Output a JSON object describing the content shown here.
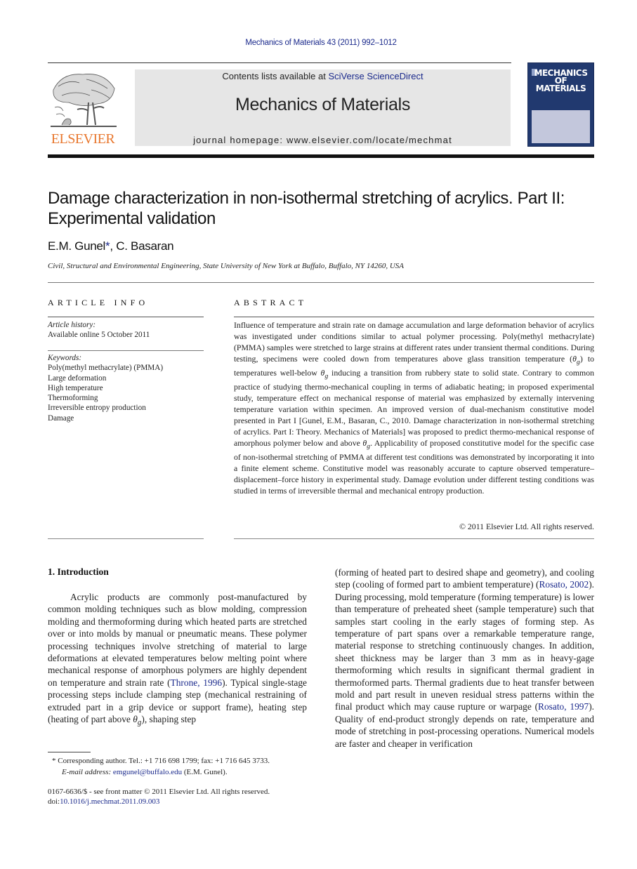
{
  "header": {
    "journal_ref": "Mechanics of Materials 43 (2011) 992–1012",
    "contents_prefix": "Contents lists available at ",
    "contents_link": "SciVerse ScienceDirect",
    "journal_title": "Mechanics of Materials",
    "homepage": "journal homepage: www.elsevier.com/locate/mechmat",
    "publisher_logo_text": "ELSEVIER",
    "cover_title_lines": [
      "MECHANICS",
      "OF",
      "MATERIALS"
    ],
    "colors": {
      "link_blue": "#1b2a8c",
      "elsevier_orange": "#e8772e",
      "cover_navy": "#21396f",
      "masthead_gray": "#e6e6e6"
    }
  },
  "article": {
    "title": "Damage characterization in non-isothermal stretching of acrylics. Part II: Experimental validation",
    "authors": [
      {
        "name": "E.M. Gunel",
        "marker": "*"
      },
      {
        "name": "C. Basaran",
        "marker": ""
      }
    ],
    "author_separator": ", ",
    "affiliation": "Civil, Structural and Environmental Engineering, State University of New York at Buffalo, Buffalo, NY 14260, USA"
  },
  "article_info": {
    "heading": "ARTICLE INFO",
    "history_label": "Article history:",
    "history_value": "Available online 5 October 2011",
    "keywords_label": "Keywords:",
    "keywords": [
      "Poly(methyl methacrylate) (PMMA)",
      "Large deformation",
      "High temperature",
      "Thermoforming",
      "Irreversible entropy production",
      "Damage"
    ]
  },
  "abstract": {
    "heading": "ABSTRACT",
    "text_1": "Influence of temperature and strain rate on damage accumulation and large deformation behavior of acrylics was investigated under conditions similar to actual polymer processing. Poly(methyl methacrylate) (PMMA) samples were stretched to large strains at different rates under transient thermal conditions. During testing, specimens were cooled down from temperatures above glass transition temperature (",
    "theta_1": "θ",
    "sub_1": "g",
    "text_2": ") to temperatures well-below ",
    "theta_2": "θ",
    "sub_2": "g",
    "text_3": " inducing a transition from rubbery state to solid state. Contrary to common practice of studying thermo-mechanical coupling in terms of adiabatic heating; in proposed experimental study, temperature effect on mechanical response of material was emphasized by externally intervening temperature variation within specimen. An improved version of dual-mechanism constitutive model presented in Part I [Gunel, E.M., Basaran, C., 2010. Damage characterization in non-isothermal stretching of acrylics. Part I: Theory. Mechanics of Materials] was proposed to predict thermo-mechanical response of amorphous polymer below and above ",
    "theta_3": "θ",
    "sub_3": "g",
    "text_4": ". Applicability of proposed constitutive model for the specific case of non-isothermal stretching of PMMA at different test conditions was demonstrated by incorporating it into a finite element scheme. Constitutive model was reasonably accurate to capture observed temperature–displacement–force history in experimental study. Damage evolution under different testing conditions was studied in terms of irreversible thermal and mechanical entropy production.",
    "copyright": "© 2011 Elsevier Ltd. All rights reserved."
  },
  "body": {
    "section_heading": "1. Introduction",
    "col1_a": "Acrylic products are commonly post-manufactured by common molding techniques such as blow molding, compression molding and thermoforming during which heated parts are stretched over or into molds by manual or pneumatic means. These polymer processing techniques involve stretching of material to large deformations at elevated temperatures below melting point where mechanical response of amorphous polymers are highly dependent on temperature and strain rate (",
    "cite_throne": "Throne, 1996",
    "col1_b": "). Typical single-stage processing steps include clamping step (mechanical restraining of extruded part in a grip device or support frame), heating step (heating of part above ",
    "theta": "θ",
    "sub": "g",
    "col1_c": "), shaping step",
    "col2_a": "(forming of heated part to desired shape and geometry), and cooling step (cooling of formed part to ambient temperature) (",
    "cite_rosato_2002": "Rosato, 2002",
    "col2_b": "). During processing, mold temperature (forming temperature) is lower than temperature of preheated sheet (sample temperature) such that samples start cooling in the early stages of forming step. As temperature of part spans over a remarkable temperature range, material response to stretching continuously changes. In addition, sheet thickness may be larger than 3 mm as in heavy-gage thermoforming which results in significant thermal gradient in thermoformed parts. Thermal gradients due to heat transfer between mold and part result in uneven residual stress patterns within the final product which may cause rupture or warpage (",
    "cite_rosato_1997": "Rosato, 1997",
    "col2_c": "). Quality of end-product strongly depends on rate, temperature and mode of stretching in post-processing operations. Numerical models are faster and cheaper in verification"
  },
  "footnote": {
    "marker": "*",
    "corresponding": " Corresponding author. Tel.: +1 716 698 1799; fax: +1 716 645 3733.",
    "email_label": "E-mail address:",
    "email": "emgunel@buffalo.edu",
    "email_suffix": " (E.M. Gunel).",
    "issn_line": "0167-6636/$ - see front matter © 2011 Elsevier Ltd. All rights reserved.",
    "doi_prefix": "doi:",
    "doi": "10.1016/j.mechmat.2011.09.003"
  }
}
